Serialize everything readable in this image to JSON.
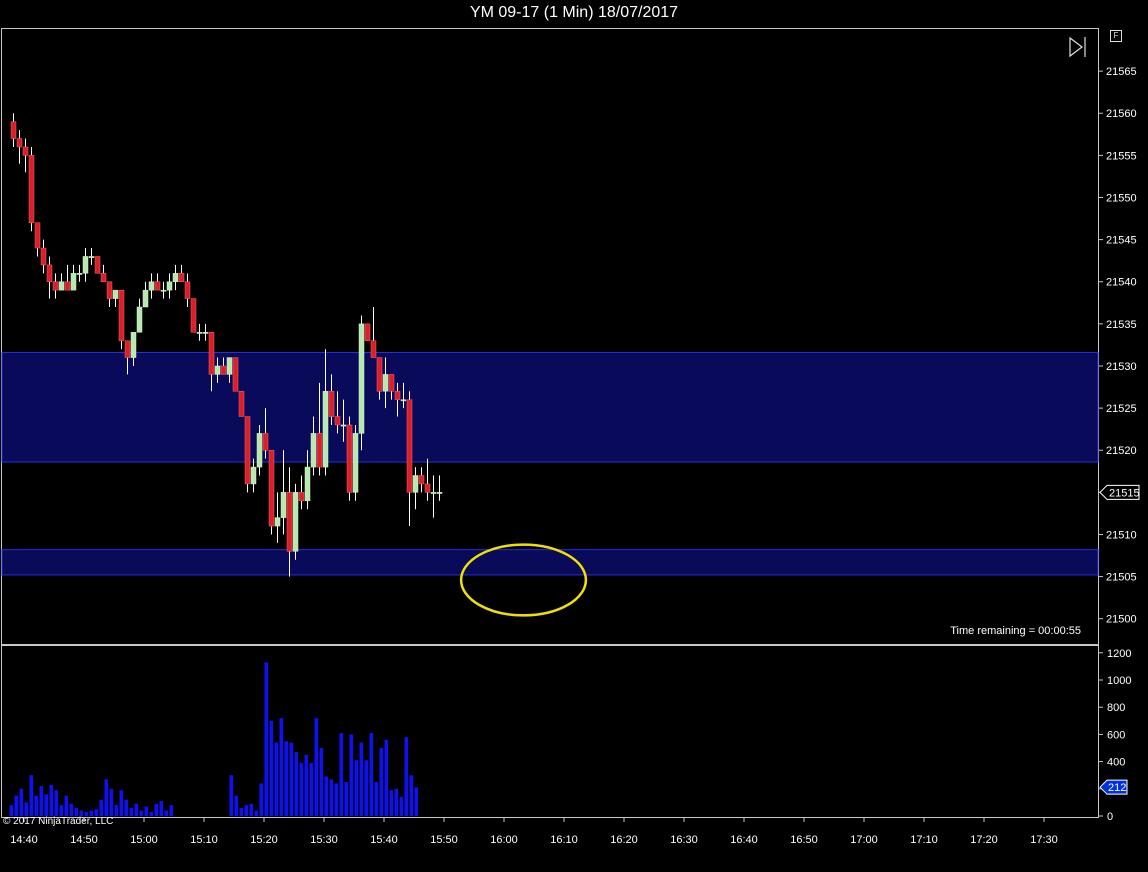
{
  "window": {
    "title": "YM 09-17 (1 Min)  18/07/2017",
    "flag_label": "F",
    "copyright": "© 2017 NinjaTrader, LLC",
    "time_remaining": "Time remaining = 00:00:55"
  },
  "colors": {
    "background": "#000000",
    "up_candle": "#b8e8b0",
    "down_candle": "#d8202a",
    "zone_fill": "#0a0a5a",
    "zone_border": "#2a2ae0",
    "volume": "#1010f0",
    "annotation": "#f0e000",
    "price_marker": "#0030e0"
  },
  "chart_data": [
    {
      "type": "candlestick",
      "title": "YM 09-17 (1 Min)  18/07/2017",
      "x_axis_labels": [
        "14:40",
        "14:50",
        "15:00",
        "15:10",
        "15:20",
        "15:30",
        "15:40",
        "15:50",
        "16:00",
        "16:10",
        "16:20",
        "16:30",
        "16:40",
        "16:50",
        "17:00",
        "17:10",
        "17:20",
        "17:30"
      ],
      "y_ticks": [
        21500,
        21505,
        21510,
        21515,
        21520,
        21525,
        21530,
        21535,
        21540,
        21545,
        21550,
        21555,
        21560,
        21565
      ],
      "ylim": [
        21497,
        21570
      ],
      "last_price": 21515,
      "start_time": "14:38",
      "bars": [
        {
          "o": 21559,
          "h": 21560,
          "l": 21556,
          "c": 21557
        },
        {
          "o": 21557,
          "h": 21558,
          "l": 21554,
          "c": 21556
        },
        {
          "o": 21556,
          "h": 21557,
          "l": 21553,
          "c": 21555
        },
        {
          "o": 21555,
          "h": 21556,
          "l": 21546,
          "c": 21547
        },
        {
          "o": 21547,
          "h": 21547,
          "l": 21543,
          "c": 21544
        },
        {
          "o": 21544,
          "h": 21545,
          "l": 21541,
          "c": 21542
        },
        {
          "o": 21542,
          "h": 21543,
          "l": 21538,
          "c": 21540
        },
        {
          "o": 21540,
          "h": 21541,
          "l": 21538,
          "c": 21539
        },
        {
          "o": 21539,
          "h": 21541,
          "l": 21539,
          "c": 21540
        },
        {
          "o": 21540,
          "h": 21542,
          "l": 21539,
          "c": 21539
        },
        {
          "o": 21539,
          "h": 21542,
          "l": 21539,
          "c": 21541
        },
        {
          "o": 21541,
          "h": 21542,
          "l": 21540,
          "c": 21541
        },
        {
          "o": 21541,
          "h": 21544,
          "l": 21540,
          "c": 21543
        },
        {
          "o": 21543,
          "h": 21544,
          "l": 21542,
          "c": 21543
        },
        {
          "o": 21543,
          "h": 21543,
          "l": 21541,
          "c": 21541
        },
        {
          "o": 21541,
          "h": 21542,
          "l": 21540,
          "c": 21540
        },
        {
          "o": 21540,
          "h": 21540,
          "l": 21537,
          "c": 21538
        },
        {
          "o": 21538,
          "h": 21539,
          "l": 21537,
          "c": 21539
        },
        {
          "o": 21539,
          "h": 21539,
          "l": 21532,
          "c": 21533
        },
        {
          "o": 21533,
          "h": 21533,
          "l": 21529,
          "c": 21531
        },
        {
          "o": 21531,
          "h": 21534,
          "l": 21530,
          "c": 21534
        },
        {
          "o": 21534,
          "h": 21538,
          "l": 21534,
          "c": 21537
        },
        {
          "o": 21537,
          "h": 21540,
          "l": 21537,
          "c": 21539
        },
        {
          "o": 21539,
          "h": 21541,
          "l": 21538,
          "c": 21540
        },
        {
          "o": 21540,
          "h": 21541,
          "l": 21539,
          "c": 21539
        },
        {
          "o": 21539,
          "h": 21540,
          "l": 21538,
          "c": 21539
        },
        {
          "o": 21539,
          "h": 21541,
          "l": 21538,
          "c": 21540
        },
        {
          "o": 21540,
          "h": 21542,
          "l": 21539,
          "c": 21541
        },
        {
          "o": 21541,
          "h": 21542,
          "l": 21540,
          "c": 21540
        },
        {
          "o": 21540,
          "h": 21541,
          "l": 21537,
          "c": 21538
        },
        {
          "o": 21538,
          "h": 21538,
          "l": 21534,
          "c": 21534
        },
        {
          "o": 21534,
          "h": 21535,
          "l": 21533,
          "c": 21534
        },
        {
          "o": 21534,
          "h": 21535,
          "l": 21533,
          "c": 21534
        },
        {
          "o": 21534,
          "h": 21534,
          "l": 21527,
          "c": 21529
        },
        {
          "o": 21529,
          "h": 21531,
          "l": 21528,
          "c": 21530
        },
        {
          "o": 21530,
          "h": 21531,
          "l": 21529,
          "c": 21529
        },
        {
          "o": 21529,
          "h": 21531,
          "l": 21528,
          "c": 21531
        },
        {
          "o": 21531,
          "h": 21531,
          "l": 21527,
          "c": 21527
        },
        {
          "o": 21527,
          "h": 21527,
          "l": 21524,
          "c": 21524
        },
        {
          "o": 21524,
          "h": 21524,
          "l": 21515,
          "c": 21516
        },
        {
          "o": 21516,
          "h": 21519,
          "l": 21515,
          "c": 21518
        },
        {
          "o": 21518,
          "h": 21523,
          "l": 21517,
          "c": 21522
        },
        {
          "o": 21522,
          "h": 21525,
          "l": 21519,
          "c": 21520
        },
        {
          "o": 21520,
          "h": 21520,
          "l": 21510,
          "c": 21511
        },
        {
          "o": 21511,
          "h": 21515,
          "l": 21509,
          "c": 21512
        },
        {
          "o": 21512,
          "h": 21520,
          "l": 21510,
          "c": 21515
        },
        {
          "o": 21515,
          "h": 21518,
          "l": 21505,
          "c": 21508
        },
        {
          "o": 21508,
          "h": 21516,
          "l": 21507,
          "c": 21515
        },
        {
          "o": 21515,
          "h": 21517,
          "l": 21513,
          "c": 21514
        },
        {
          "o": 21514,
          "h": 21520,
          "l": 21513,
          "c": 21518
        },
        {
          "o": 21518,
          "h": 21524,
          "l": 21517,
          "c": 21522
        },
        {
          "o": 21522,
          "h": 21528,
          "l": 21517,
          "c": 21518
        },
        {
          "o": 21518,
          "h": 21532,
          "l": 21517,
          "c": 21527
        },
        {
          "o": 21527,
          "h": 21529,
          "l": 21523,
          "c": 21524
        },
        {
          "o": 21524,
          "h": 21527,
          "l": 21522,
          "c": 21523
        },
        {
          "o": 21523,
          "h": 21526,
          "l": 21521,
          "c": 21523
        },
        {
          "o": 21523,
          "h": 21524,
          "l": 21514,
          "c": 21515
        },
        {
          "o": 21515,
          "h": 21523,
          "l": 21514,
          "c": 21522
        },
        {
          "o": 21522,
          "h": 21536,
          "l": 21520,
          "c": 21535
        },
        {
          "o": 21535,
          "h": 21535,
          "l": 21533,
          "c": 21533
        },
        {
          "o": 21533,
          "h": 21537,
          "l": 21531,
          "c": 21531
        },
        {
          "o": 21531,
          "h": 21531,
          "l": 21526,
          "c": 21527
        },
        {
          "o": 21527,
          "h": 21531,
          "l": 21525,
          "c": 21529
        },
        {
          "o": 21529,
          "h": 21529,
          "l": 21526,
          "c": 21527
        },
        {
          "o": 21527,
          "h": 21528,
          "l": 21524,
          "c": 21526
        },
        {
          "o": 21526,
          "h": 21528,
          "l": 21525,
          "c": 21526
        },
        {
          "o": 21526,
          "h": 21527,
          "l": 21511,
          "c": 21515
        },
        {
          "o": 21515,
          "h": 21518,
          "l": 21513,
          "c": 21517
        },
        {
          "o": 21517,
          "h": 21518,
          "l": 21515,
          "c": 21516
        },
        {
          "o": 21516,
          "h": 21519,
          "l": 21514,
          "c": 21515
        },
        {
          "o": 21515,
          "h": 21517,
          "l": 21512,
          "c": 21515
        },
        {
          "o": 21515,
          "h": 21517,
          "l": 21514,
          "c": 21515
        }
      ],
      "zones": [
        {
          "from": 21518.6,
          "to": 21531.6
        },
        {
          "from": 21505.2,
          "to": 21508.2
        }
      ],
      "ellipse": {
        "center_time_min": 85,
        "center_price": 21504.6,
        "half_width_min": 10.4,
        "half_height_price": 4.2
      }
    },
    {
      "type": "bar",
      "series_name": "Volume",
      "y_ticks": [
        0,
        200,
        400,
        600,
        800,
        1000,
        1200
      ],
      "ylim": [
        0,
        1250
      ],
      "last_value": 212,
      "values": [
        80,
        150,
        200,
        100,
        300,
        150,
        220,
        160,
        230,
        190,
        80,
        150,
        90,
        60,
        40,
        30,
        40,
        50,
        120,
        270,
        200,
        80,
        190,
        120,
        60,
        90,
        40,
        70,
        30,
        90,
        110,
        40,
        80,
        0,
        0,
        0,
        0,
        0,
        0,
        0,
        0,
        0,
        0,
        0,
        300,
        150,
        60,
        80,
        90,
        40,
        240,
        1130,
        700,
        540,
        720,
        550,
        540,
        470,
        390,
        450,
        390,
        720,
        500,
        290,
        270,
        240,
        610,
        250,
        600,
        410,
        540,
        410,
        610,
        250,
        500,
        560,
        190,
        200,
        140,
        580,
        300,
        210
      ]
    }
  ]
}
